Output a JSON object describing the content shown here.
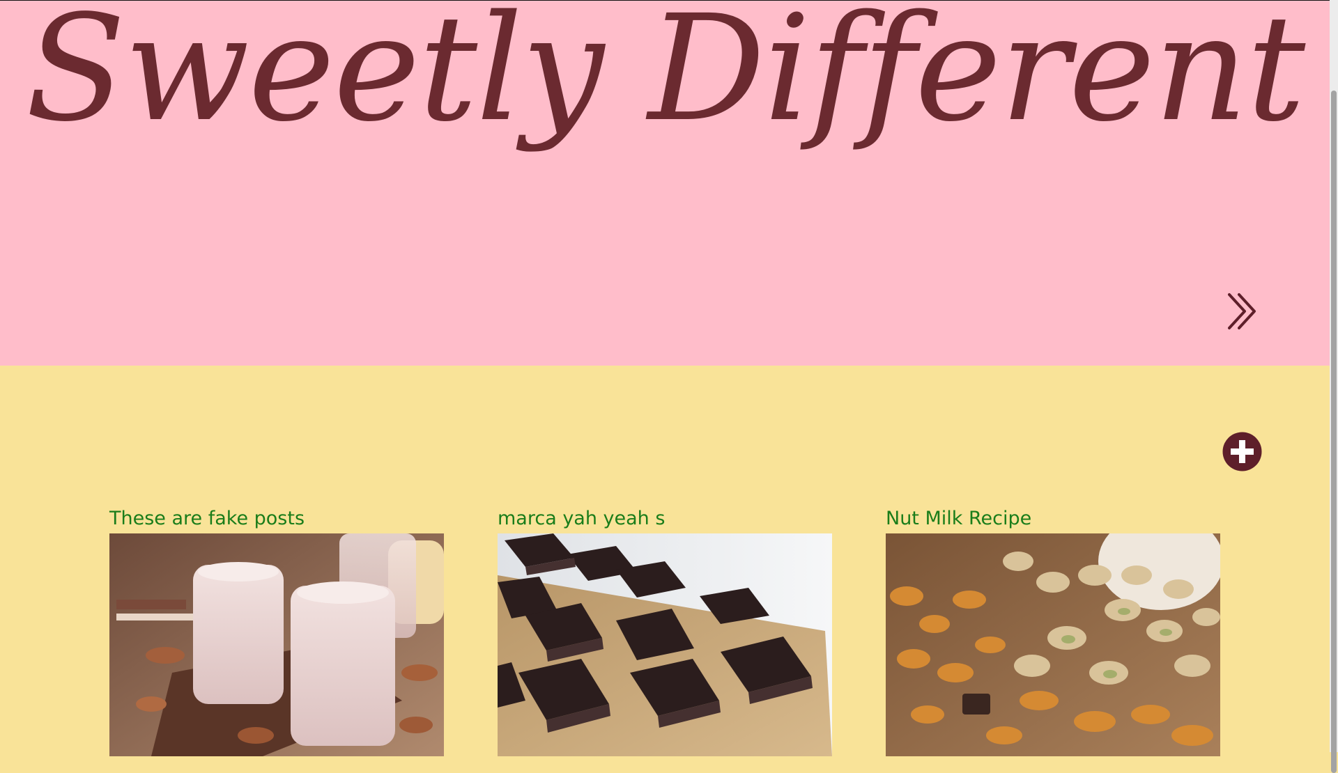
{
  "brand": {
    "title": "Sweetly Different"
  },
  "hero": {
    "next_icon": "double-chevron-right-icon"
  },
  "toolbar": {
    "add_icon": "plus-circle-icon",
    "accent": "#5e1f2a"
  },
  "colors": {
    "hero_bg": "#ffbdca",
    "posts_bg": "#f9e398",
    "title_color": "#1a7d1a",
    "brand_color": "#6b2a30"
  },
  "posts": [
    {
      "title": "These are fake posts",
      "image": "almond-milkshake-photo"
    },
    {
      "title": "marca yah yeah s",
      "image": "chocolate-bars-photo"
    },
    {
      "title": "Nut Milk Recipe",
      "image": "mixed-nuts-photo"
    }
  ]
}
